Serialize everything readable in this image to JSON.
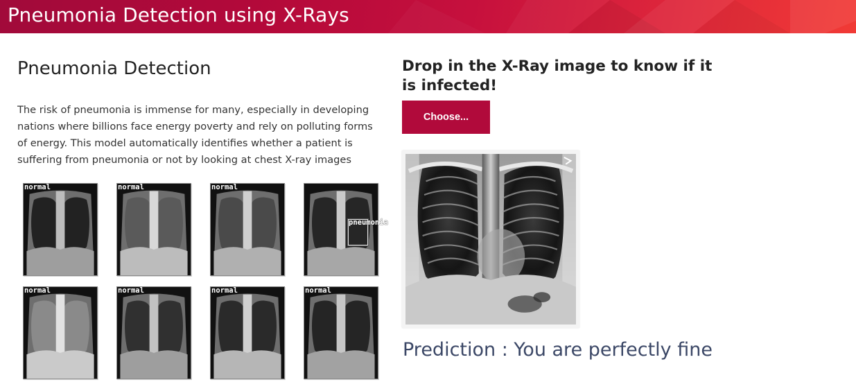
{
  "header": {
    "title": "Pneumonia Detection using X-Rays"
  },
  "left": {
    "title": "Pneumonia Detection",
    "description": "The risk of pneumonia is immense for many, especially in developing nations where billions face energy poverty and rely on polluting forms of energy. This model automatically identifies whether a patient is suffering from pneumonia or not by looking at chest X-ray images",
    "samples": [
      {
        "label": "normal"
      },
      {
        "label": "normal"
      },
      {
        "label": "normal"
      },
      {
        "label": ""
      },
      {
        "label": "normal"
      },
      {
        "label": "normal"
      },
      {
        "label": "normal"
      },
      {
        "label": "normal"
      }
    ],
    "detection_label": "pneumonia"
  },
  "right": {
    "title": "Drop in the X-Ray image to know if it is infected!",
    "choose_label": "Choose...",
    "prediction": "Prediction : You are perfectly fine"
  },
  "colors": {
    "accent": "#b10a3b",
    "prediction_text": "#3b4766"
  }
}
